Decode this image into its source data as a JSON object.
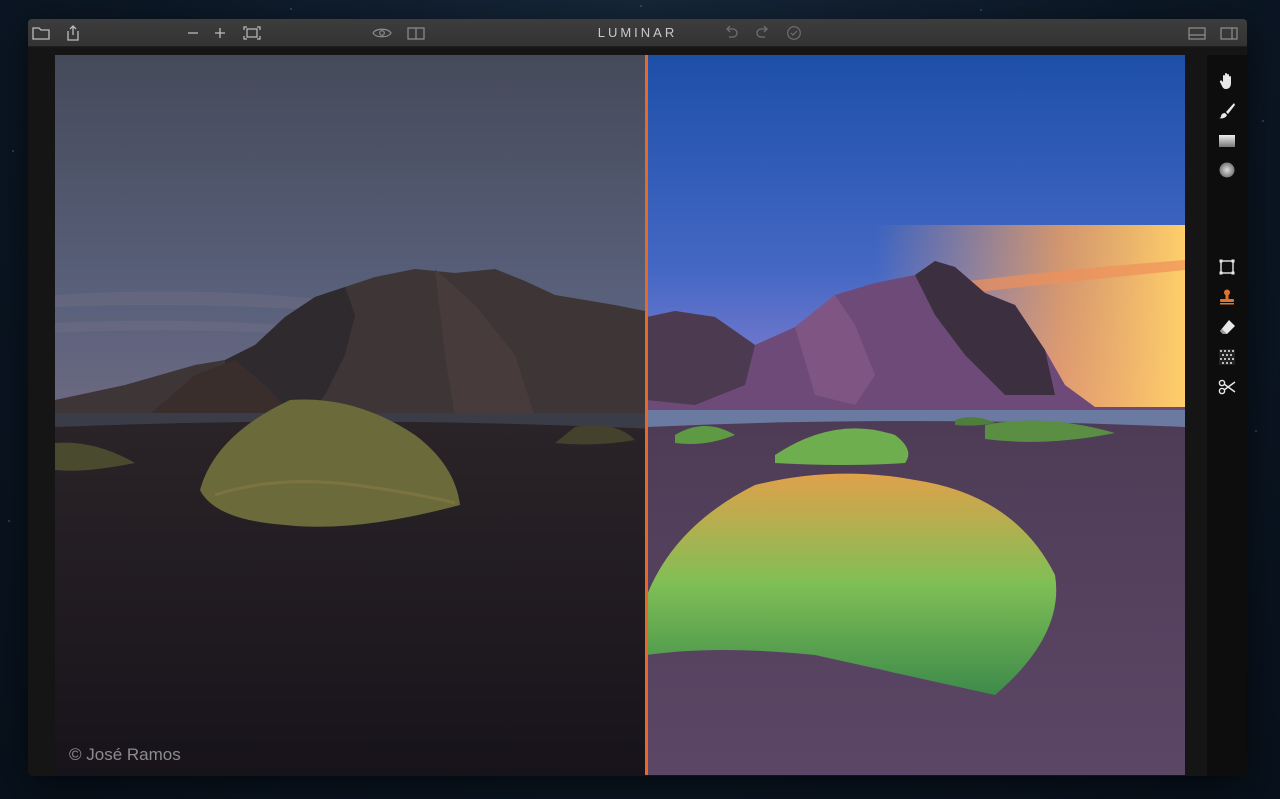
{
  "app": {
    "title": "LUMINAR"
  },
  "titlebar": {
    "left_icons": [
      "folder-icon",
      "share-icon"
    ],
    "zoom_icons": [
      "zoom-out-icon",
      "zoom-in-icon",
      "fit-screen-icon"
    ],
    "view_icons": [
      "preview-eye-icon",
      "compare-split-icon"
    ],
    "history_icons": [
      "undo-icon",
      "redo-icon",
      "history-icon"
    ],
    "right_icons": [
      "filmstrip-panel-icon",
      "side-panel-icon"
    ]
  },
  "canvas": {
    "copyright": "© José Ramos",
    "divider_color": "#e56a2a"
  },
  "tools": [
    "hand-icon",
    "brush-icon",
    "gradient-mask-icon",
    "radial-mask-icon",
    "crop-icon",
    "clone-stamp-icon",
    "eraser-icon",
    "noise-icon",
    "scissors-icon"
  ],
  "colors": {
    "accent": "#e56a2a",
    "active_tool": "#e5722a"
  }
}
